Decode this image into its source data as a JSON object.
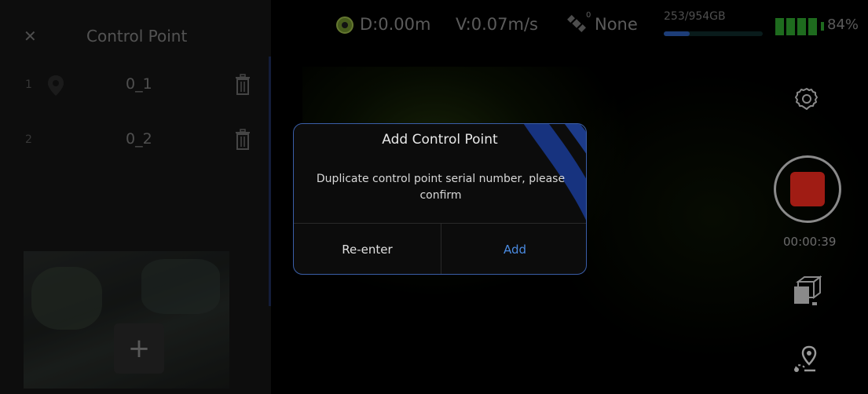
{
  "panel": {
    "close_icon": "close-icon",
    "title": "Control Point",
    "points": [
      {
        "number": "1",
        "label": "0_1"
      },
      {
        "number": "2",
        "label": "0_2"
      }
    ],
    "add_icon": "plus-icon"
  },
  "status": {
    "distance": "D:0.00m",
    "velocity": "V:0.07m/s",
    "satellite_count": "0",
    "rtk": "None",
    "storage": "253/954GB",
    "storage_used_fraction": 0.265,
    "battery": "84%",
    "battery_level": 0.84
  },
  "controls": {
    "timer": "00:00:39"
  },
  "dialog": {
    "title": "Add Control Point",
    "message": "Duplicate control point serial number, please confirm",
    "reenter_label": "Re-enter",
    "add_label": "Add"
  },
  "colors": {
    "accent": "#4a8ae0",
    "record": "#a01c14",
    "battery": "#2fa52f"
  }
}
